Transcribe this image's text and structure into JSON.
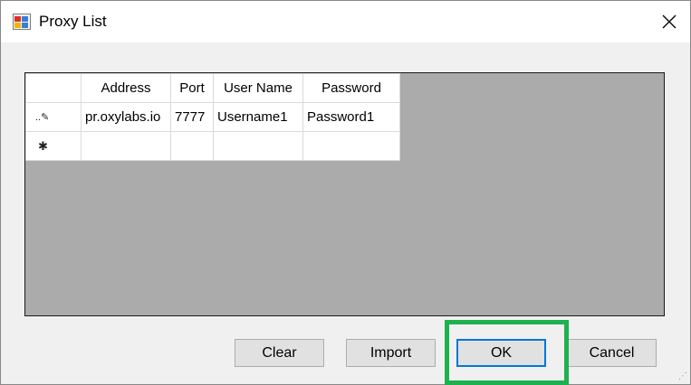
{
  "window": {
    "title": "Proxy List"
  },
  "grid": {
    "columns": [
      "Address",
      "Port",
      "User Name",
      "Password"
    ],
    "rows": [
      {
        "address": "pr.oxylabs.io",
        "port": "7777",
        "username": "Username1",
        "password": "Password1"
      }
    ]
  },
  "buttons": {
    "clear": "Clear",
    "import": "Import",
    "ok": "OK",
    "cancel": "Cancel"
  },
  "colors": {
    "highlight": "#1db150",
    "grid_background": "#ababab",
    "ok_focus": "#0078d7"
  }
}
